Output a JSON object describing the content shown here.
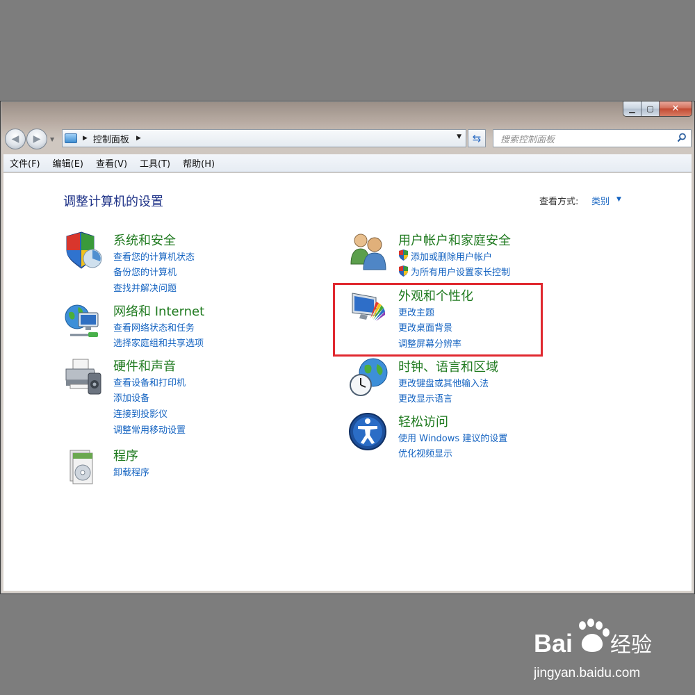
{
  "window": {
    "address_path": "控制面板",
    "search_placeholder": "搜索控制面板",
    "menus": [
      "文件(F)",
      "编辑(E)",
      "查看(V)",
      "工具(T)",
      "帮助(H)"
    ]
  },
  "content": {
    "page_title": "调整计算机的设置",
    "view_by_label": "查看方式:",
    "view_by_value": "类别",
    "categories": [
      {
        "title": "系统和安全",
        "icon": "shield-icon",
        "links": [
          "查看您的计算机状态",
          "备份您的计算机",
          "查找并解决问题"
        ]
      },
      {
        "title": "网络和 Internet",
        "icon": "network-globe-icon",
        "links": [
          "查看网络状态和任务",
          "选择家庭组和共享选项"
        ]
      },
      {
        "title": "硬件和声音",
        "icon": "printer-icon",
        "links": [
          "查看设备和打印机",
          "添加设备",
          "连接到投影仪",
          "调整常用移动设置"
        ]
      },
      {
        "title": "程序",
        "icon": "programs-icon",
        "links": [
          "卸载程序"
        ]
      },
      {
        "title": "用户帐户和家庭安全",
        "icon": "users-icon",
        "links": [
          "添加或删除用户帐户",
          "为所有用户设置家长控制"
        ]
      },
      {
        "title": "外观和个性化",
        "icon": "monitor-palette-icon",
        "links": [
          "更改主题",
          "更改桌面背景",
          "调整屏幕分辨率"
        ]
      },
      {
        "title": "时钟、语言和区域",
        "icon": "clock-globe-icon",
        "links": [
          "更改键盘或其他输入法",
          "更改显示语言"
        ]
      },
      {
        "title": "轻松访问",
        "icon": "ease-of-access-icon",
        "links": [
          "使用 Windows 建议的设置",
          "优化视频显示"
        ]
      }
    ]
  },
  "watermark": {
    "brand": "Bai",
    "brand_suffix": "经验",
    "url": "jingyan.baidu.com"
  },
  "colors": {
    "link": "#1463c1",
    "category_title": "#1f7a1f",
    "page_title": "#1e3287",
    "highlight": "#e0282f"
  }
}
